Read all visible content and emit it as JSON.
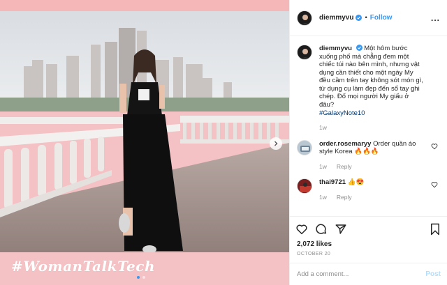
{
  "colors": {
    "accent": "#3897f0",
    "pink_frame": "#f4c1c4",
    "text": "#262626",
    "muted": "#8e8e8e"
  },
  "post": {
    "image_caption_overlay": "#WomanTalkTech",
    "carousel_dots": 2,
    "carousel_active": 0
  },
  "header": {
    "username": "diemmyvu",
    "separator": "•",
    "follow_label": "Follow",
    "more_label": "..."
  },
  "caption": {
    "username": "diemmyvu",
    "text": "Một hôm bước xuống phố mà chẳng đem một chiếc túi nào bên mình, nhưng vật dụng cần thiết cho một ngày My đều cầm trên tay không sót món gì, từ dụng cụ làm đẹp đến sổ tay ghi chép. Đố mọi người My giấu ở đâu?",
    "hashtag": "#GalaxyNote10",
    "time": "1w"
  },
  "comments": [
    {
      "username": "order.rosemaryy",
      "text": "Order quần áo style Korea",
      "emoji": "🔥🔥🔥",
      "time": "1w",
      "reply_label": "Reply"
    },
    {
      "username": "thai9721",
      "text": "",
      "emoji": "👍😍",
      "time": "1w",
      "reply_label": "Reply"
    }
  ],
  "actions": {
    "likes": "2,072 likes",
    "date": "OCTOBER 20"
  },
  "add_comment": {
    "placeholder": "Add a comment...",
    "post_label": "Post"
  },
  "icons": [
    "verified-badge-icon",
    "heart-icon",
    "comment-icon",
    "share-icon",
    "bookmark-icon",
    "chevron-right-icon"
  ]
}
